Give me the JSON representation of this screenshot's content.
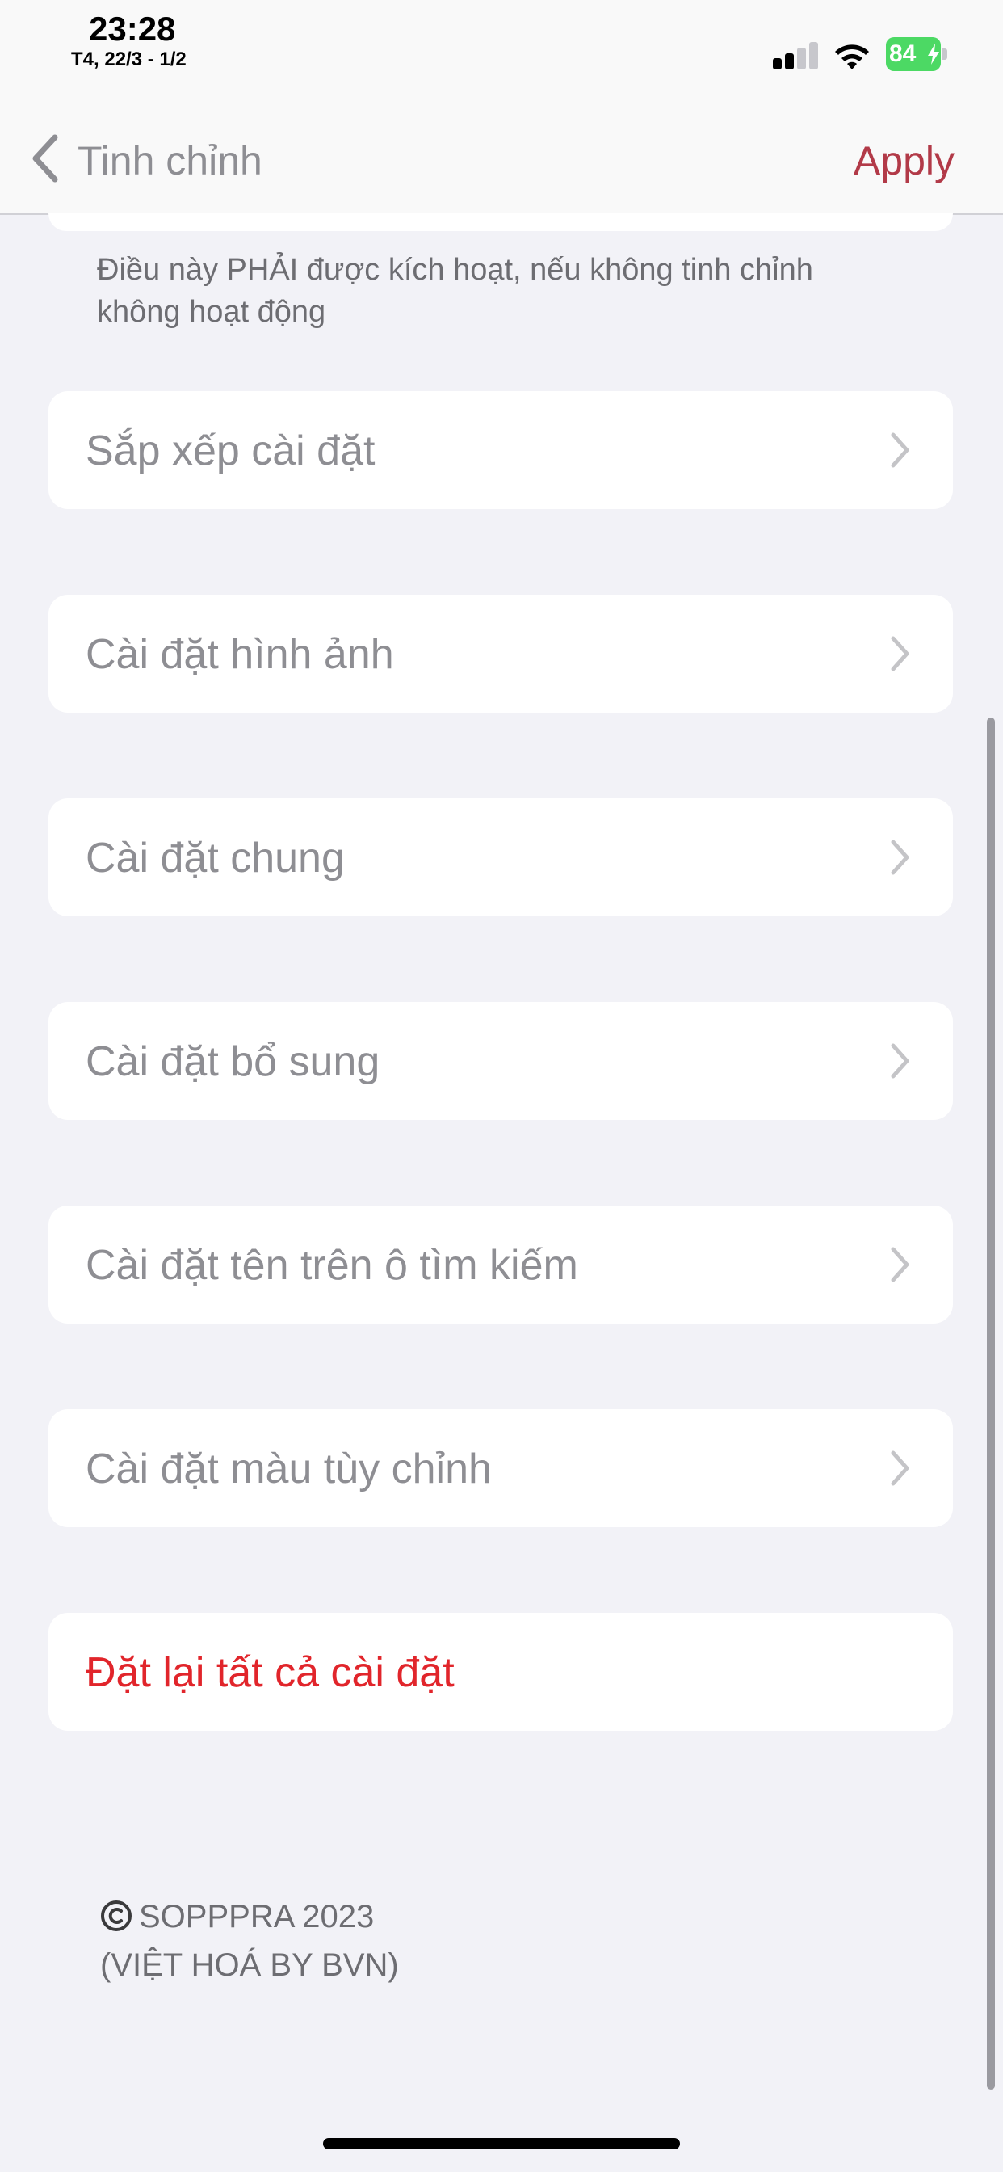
{
  "status_bar": {
    "time": "23:28",
    "date": "T4, 22/3 - 1/2",
    "battery_percent": "84",
    "signal_bars_active": 2,
    "signal_bars_total": 4
  },
  "nav": {
    "back_label": "Tinh chỉnh",
    "apply_label": "Apply"
  },
  "footnote": "Điều này PHẢI được kích hoạt, nếu không tinh chỉnh không hoạt động",
  "menu": {
    "items": [
      {
        "label": "Sắp xếp cài đặt"
      },
      {
        "label": "Cài đặt hình ảnh"
      },
      {
        "label": "Cài đặt chung"
      },
      {
        "label": "Cài đặt bổ sung"
      },
      {
        "label": "Cài đặt tên trên ô tìm kiếm"
      },
      {
        "label": "Cài đặt màu tùy chỉnh"
      }
    ],
    "reset_label": "Đặt lại tất cả cài đặt"
  },
  "footer": {
    "line1": "SOPPPRA 2023",
    "line2": "(VIỆT HOÁ BY BVN)"
  },
  "colors": {
    "accent": "#b23a48",
    "destructive": "#e1252b",
    "background": "#f2f2f7",
    "label_gray": "#8e8e93"
  }
}
